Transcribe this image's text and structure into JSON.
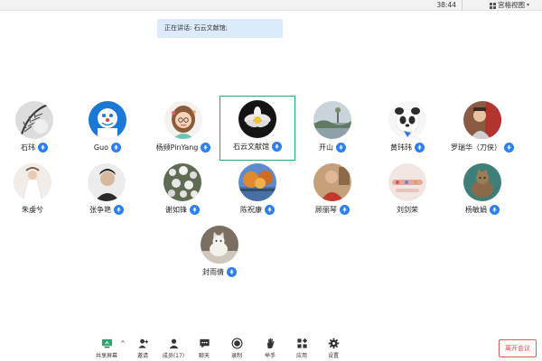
{
  "topbar": {
    "timer": "38:44",
    "view_label": "宫格视图"
  },
  "speaker_banner": "正在讲话: 石云文献馆;",
  "participants": [
    {
      "name": "石玮",
      "avatar": "fern-photo"
    },
    {
      "name": "Guo",
      "avatar": "cartoon-blue"
    },
    {
      "name": "杨频PinYang",
      "avatar": "girl-emoji"
    },
    {
      "name": "石云文献馆",
      "avatar": "lotus-photo",
      "active": true
    },
    {
      "name": "开山",
      "avatar": "landscape-photo"
    },
    {
      "name": "黄玮玮",
      "avatar": "panda-cartoon"
    },
    {
      "name": "罗瑞华（刀侠）",
      "avatar": "portrait-photo"
    },
    {
      "name": "朱虔兮",
      "avatar": "bride-photo"
    },
    {
      "name": "张争艳",
      "avatar": "person-photo"
    },
    {
      "name": "谢如锋",
      "avatar": "flowers-photo"
    },
    {
      "name": "陈祝康",
      "avatar": "autumn-photo"
    },
    {
      "name": "顾丽琴",
      "avatar": "person-red"
    },
    {
      "name": "刘剑荣",
      "avatar": "pink-photo"
    },
    {
      "name": "杨敏娟",
      "avatar": "cat-photo"
    },
    {
      "name": "封雨倩",
      "avatar": "cat-desk-photo"
    }
  ],
  "toolbar": {
    "share": "共享屏幕",
    "invite": "邀请",
    "members": "成员(17)",
    "chat": "聊天",
    "record": "录制",
    "raise_hand": "举手",
    "apps": "应用",
    "settings": "设置"
  },
  "leave_label": "离开会议",
  "colors": {
    "accent_blue": "#2d7ff0",
    "active_border": "#2aa86b",
    "leave_red": "#e04848",
    "banner_bg": "#dcebfc"
  }
}
